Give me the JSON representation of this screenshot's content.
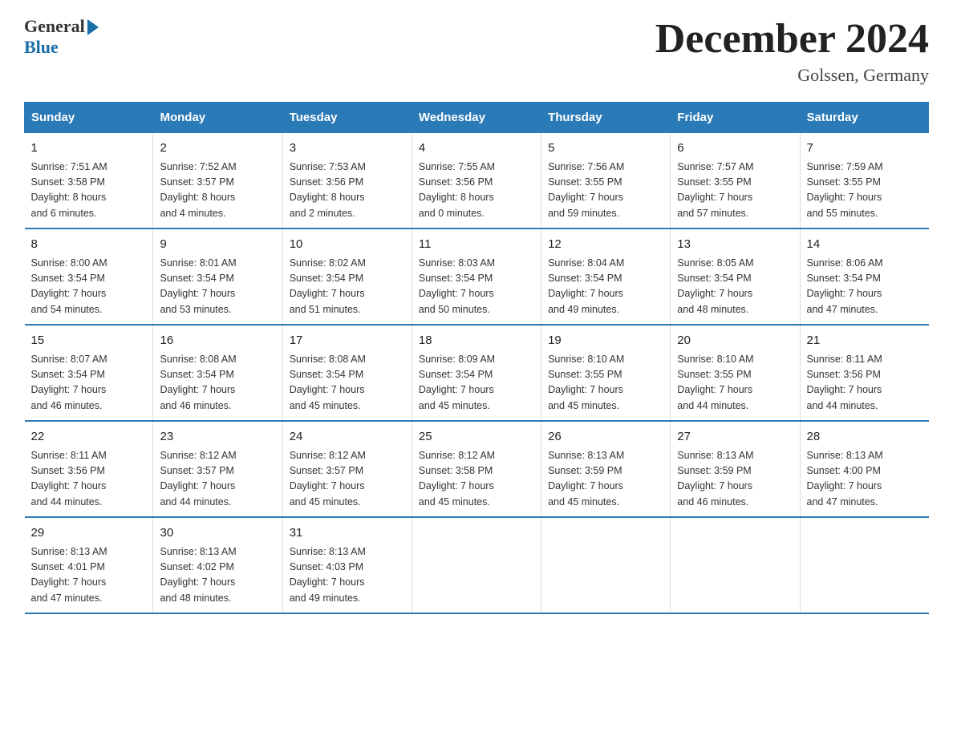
{
  "logo": {
    "general": "General",
    "blue": "Blue"
  },
  "title": "December 2024",
  "subtitle": "Golssen, Germany",
  "columns": [
    "Sunday",
    "Monday",
    "Tuesday",
    "Wednesday",
    "Thursday",
    "Friday",
    "Saturday"
  ],
  "weeks": [
    [
      {
        "day": "1",
        "info": "Sunrise: 7:51 AM\nSunset: 3:58 PM\nDaylight: 8 hours\nand 6 minutes."
      },
      {
        "day": "2",
        "info": "Sunrise: 7:52 AM\nSunset: 3:57 PM\nDaylight: 8 hours\nand 4 minutes."
      },
      {
        "day": "3",
        "info": "Sunrise: 7:53 AM\nSunset: 3:56 PM\nDaylight: 8 hours\nand 2 minutes."
      },
      {
        "day": "4",
        "info": "Sunrise: 7:55 AM\nSunset: 3:56 PM\nDaylight: 8 hours\nand 0 minutes."
      },
      {
        "day": "5",
        "info": "Sunrise: 7:56 AM\nSunset: 3:55 PM\nDaylight: 7 hours\nand 59 minutes."
      },
      {
        "day": "6",
        "info": "Sunrise: 7:57 AM\nSunset: 3:55 PM\nDaylight: 7 hours\nand 57 minutes."
      },
      {
        "day": "7",
        "info": "Sunrise: 7:59 AM\nSunset: 3:55 PM\nDaylight: 7 hours\nand 55 minutes."
      }
    ],
    [
      {
        "day": "8",
        "info": "Sunrise: 8:00 AM\nSunset: 3:54 PM\nDaylight: 7 hours\nand 54 minutes."
      },
      {
        "day": "9",
        "info": "Sunrise: 8:01 AM\nSunset: 3:54 PM\nDaylight: 7 hours\nand 53 minutes."
      },
      {
        "day": "10",
        "info": "Sunrise: 8:02 AM\nSunset: 3:54 PM\nDaylight: 7 hours\nand 51 minutes."
      },
      {
        "day": "11",
        "info": "Sunrise: 8:03 AM\nSunset: 3:54 PM\nDaylight: 7 hours\nand 50 minutes."
      },
      {
        "day": "12",
        "info": "Sunrise: 8:04 AM\nSunset: 3:54 PM\nDaylight: 7 hours\nand 49 minutes."
      },
      {
        "day": "13",
        "info": "Sunrise: 8:05 AM\nSunset: 3:54 PM\nDaylight: 7 hours\nand 48 minutes."
      },
      {
        "day": "14",
        "info": "Sunrise: 8:06 AM\nSunset: 3:54 PM\nDaylight: 7 hours\nand 47 minutes."
      }
    ],
    [
      {
        "day": "15",
        "info": "Sunrise: 8:07 AM\nSunset: 3:54 PM\nDaylight: 7 hours\nand 46 minutes."
      },
      {
        "day": "16",
        "info": "Sunrise: 8:08 AM\nSunset: 3:54 PM\nDaylight: 7 hours\nand 46 minutes."
      },
      {
        "day": "17",
        "info": "Sunrise: 8:08 AM\nSunset: 3:54 PM\nDaylight: 7 hours\nand 45 minutes."
      },
      {
        "day": "18",
        "info": "Sunrise: 8:09 AM\nSunset: 3:54 PM\nDaylight: 7 hours\nand 45 minutes."
      },
      {
        "day": "19",
        "info": "Sunrise: 8:10 AM\nSunset: 3:55 PM\nDaylight: 7 hours\nand 45 minutes."
      },
      {
        "day": "20",
        "info": "Sunrise: 8:10 AM\nSunset: 3:55 PM\nDaylight: 7 hours\nand 44 minutes."
      },
      {
        "day": "21",
        "info": "Sunrise: 8:11 AM\nSunset: 3:56 PM\nDaylight: 7 hours\nand 44 minutes."
      }
    ],
    [
      {
        "day": "22",
        "info": "Sunrise: 8:11 AM\nSunset: 3:56 PM\nDaylight: 7 hours\nand 44 minutes."
      },
      {
        "day": "23",
        "info": "Sunrise: 8:12 AM\nSunset: 3:57 PM\nDaylight: 7 hours\nand 44 minutes."
      },
      {
        "day": "24",
        "info": "Sunrise: 8:12 AM\nSunset: 3:57 PM\nDaylight: 7 hours\nand 45 minutes."
      },
      {
        "day": "25",
        "info": "Sunrise: 8:12 AM\nSunset: 3:58 PM\nDaylight: 7 hours\nand 45 minutes."
      },
      {
        "day": "26",
        "info": "Sunrise: 8:13 AM\nSunset: 3:59 PM\nDaylight: 7 hours\nand 45 minutes."
      },
      {
        "day": "27",
        "info": "Sunrise: 8:13 AM\nSunset: 3:59 PM\nDaylight: 7 hours\nand 46 minutes."
      },
      {
        "day": "28",
        "info": "Sunrise: 8:13 AM\nSunset: 4:00 PM\nDaylight: 7 hours\nand 47 minutes."
      }
    ],
    [
      {
        "day": "29",
        "info": "Sunrise: 8:13 AM\nSunset: 4:01 PM\nDaylight: 7 hours\nand 47 minutes."
      },
      {
        "day": "30",
        "info": "Sunrise: 8:13 AM\nSunset: 4:02 PM\nDaylight: 7 hours\nand 48 minutes."
      },
      {
        "day": "31",
        "info": "Sunrise: 8:13 AM\nSunset: 4:03 PM\nDaylight: 7 hours\nand 49 minutes."
      },
      {
        "day": "",
        "info": ""
      },
      {
        "day": "",
        "info": ""
      },
      {
        "day": "",
        "info": ""
      },
      {
        "day": "",
        "info": ""
      }
    ]
  ],
  "accent_color": "#2a7ab8"
}
